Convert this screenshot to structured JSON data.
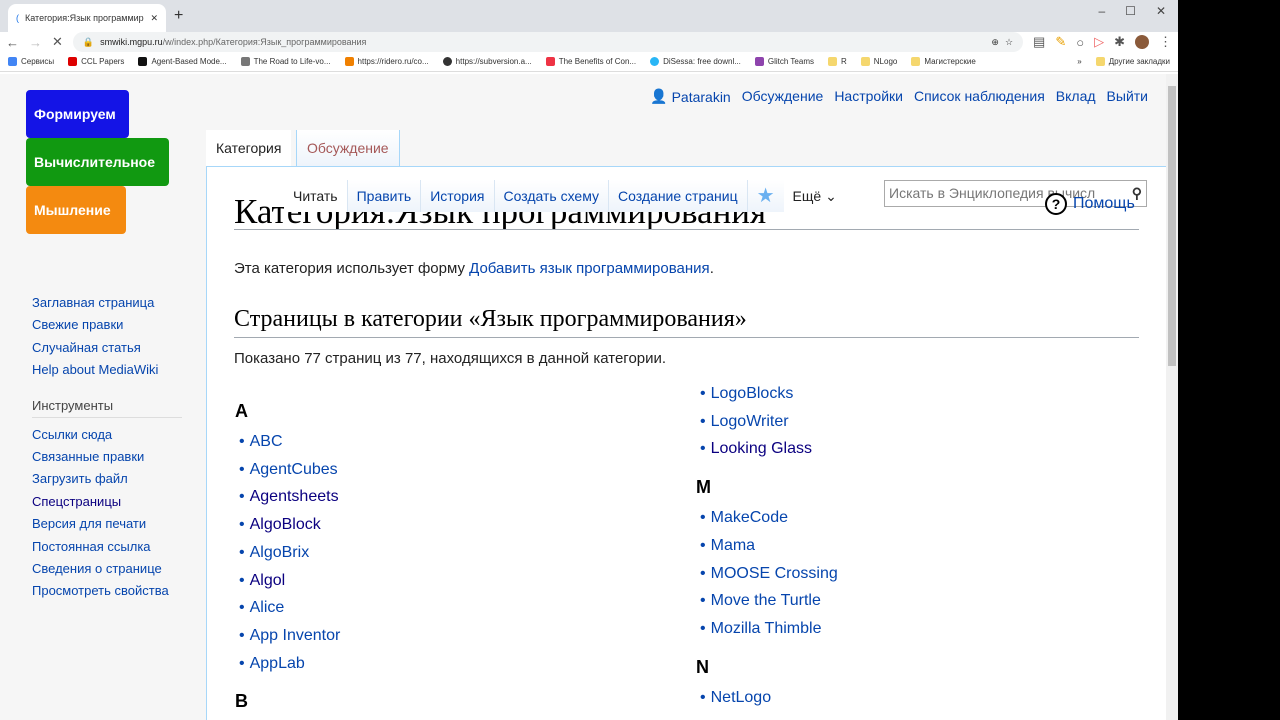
{
  "browser": {
    "tab_title": "Категория:Язык программирова",
    "url_host": "smwiki.mgpu.ru",
    "url_path": "/w/index.php/Категория:Язык_программирования",
    "bookmarks": [
      "Сервисы",
      "CCL Papers",
      "Agent-Based Mode...",
      "The Road to Life-vo...",
      "https://ridero.ru/co...",
      "https://subversion.a...",
      "The Benefits of Con...",
      "DiSessa: free downl...",
      "Glitch Teams",
      "R",
      "NLogo",
      "Магистерские"
    ],
    "other_bookmarks": "Другие закладки"
  },
  "logo": [
    "Формируем",
    "Вычислительное",
    "Мышление"
  ],
  "personal": {
    "user": "Patarakin",
    "links": [
      "Обсуждение",
      "Настройки",
      "Список наблюдения",
      "Вклад",
      "Выйти"
    ]
  },
  "namespaces": [
    "Категория",
    "Обсуждение"
  ],
  "views": [
    "Читать",
    "Править",
    "История",
    "Создать схему",
    "Создание страниц"
  ],
  "more": "Ещё",
  "search_placeholder": "Искать в Энциклопедия вычисл",
  "help": "Помощь",
  "nav": [
    "Заглавная страница",
    "Свежие правки",
    "Случайная статья",
    "Help about MediaWiki"
  ],
  "tools_heading": "Инструменты",
  "tools": [
    "Ссылки сюда",
    "Связанные правки",
    "Загрузить файл",
    "Спецстраницы",
    "Версия для печати",
    "Постоянная ссылка",
    "Сведения о странице",
    "Просмотреть свойства"
  ],
  "title": "Категория:Язык программирования",
  "intro": {
    "before": "Эта категория использует форму ",
    "link": "Добавить язык программирования",
    "after": "."
  },
  "heading": "Страницы в категории «Язык программирования»",
  "count_text": "Показано 77 страниц из 77, находящихся в данной категории.",
  "col1": {
    "A": [
      "ABC",
      "AgentCubes",
      "Agentsheets",
      "AlgoBlock",
      "AlgoBrix",
      "Algol",
      "Alice",
      "App Inventor",
      "AppLab"
    ],
    "B": "B"
  },
  "col2": {
    "L_tail": [
      "LogoBlocks",
      "LogoWriter",
      "Looking Glass"
    ],
    "M": [
      "MakeCode",
      "Mama",
      "MOOSE Crossing",
      "Move the Turtle",
      "Mozilla Thimble"
    ],
    "N": [
      "NetLogo"
    ]
  },
  "letters": {
    "a": "A",
    "b": "B",
    "m": "M",
    "n": "N"
  }
}
